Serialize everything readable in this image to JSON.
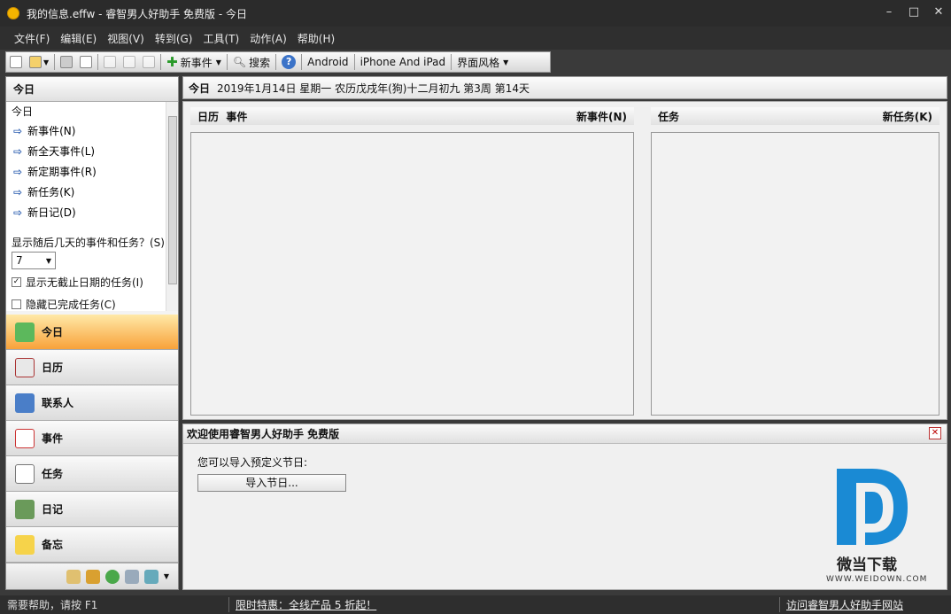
{
  "window": {
    "title": "我的信息.effw - 睿智男人好助手 免费版 - 今日",
    "min": "–",
    "max": "□",
    "close": "✕"
  },
  "menu": [
    "文件(F)",
    "编辑(E)",
    "视图(V)",
    "转到(G)",
    "工具(T)",
    "动作(A)",
    "帮助(H)"
  ],
  "toolbar": {
    "new_event": "新事件",
    "search": "搜索",
    "help_icon": "?",
    "android": "Android",
    "iphone": "iPhone And iPad",
    "theme": "界面风格"
  },
  "left": {
    "header": "今日",
    "quick_sub": "今日",
    "quick_items": [
      "新事件(N)",
      "新全天事件(L)",
      "新定期事件(R)",
      "新任务(K)",
      "新日记(D)"
    ],
    "days_label": "显示随后几天的事件和任务？(S)",
    "days_value": "7",
    "check1": "显示无截止日期的任务(I)",
    "check2": "隐藏已完成任务(C)",
    "nav": [
      "今日",
      "日历",
      "联系人",
      "事件",
      "任务",
      "日记",
      "备忘"
    ]
  },
  "today_bar": {
    "label": "今日",
    "date": "2019年1月14日 星期一 农历戊戌年(狗)十二月初九 第3周 第14天"
  },
  "events": {
    "col1": "日历",
    "col2": "事件",
    "new": "新事件(N)"
  },
  "tasks": {
    "title": "任务",
    "new": "新任务(K)"
  },
  "welcome": {
    "title": "欢迎使用睿智男人好助手 免费版",
    "text": "您可以导入预定义节日:",
    "button": "导入节日..."
  },
  "watermark": {
    "name": "微当下载",
    "url": "WWW.WEIDOWN.COM"
  },
  "status": {
    "help": "需要帮助，请按 F1",
    "promo": "限时特惠：全线产品 5 折起！",
    "site": "访问睿智男人好助手网站"
  }
}
